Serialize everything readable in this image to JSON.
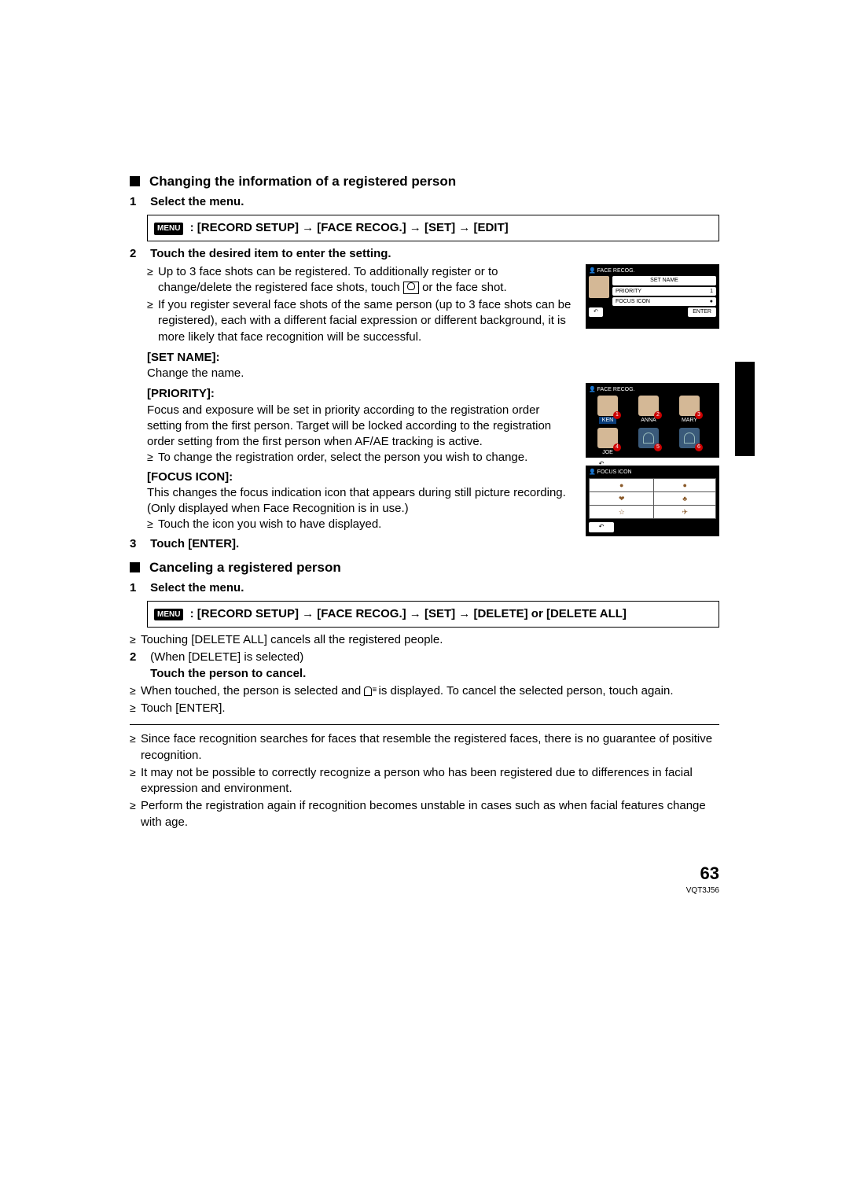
{
  "section1": {
    "title": "Changing the information of a registered person",
    "step1": {
      "num": "1",
      "title": "Select the menu."
    },
    "menu1": {
      "badge": "MENU",
      "path": ": [RECORD SETUP] → [FACE RECOG.] → [SET] → [EDIT]"
    },
    "step2": {
      "num": "2",
      "title": "Touch the desired item to enter the setting."
    },
    "bullets1": [
      "Up to 3 face shots can be registered. To additionally register or to change/delete the registered face shots, touch",
      "or the face shot.",
      "If you register several face shots of the same person (up to 3 face shots can be registered), each with a different facial expression or different background, it is more likely that face recognition will be successful."
    ],
    "setname": {
      "label": "[SET NAME]:",
      "text": "Change the name."
    },
    "priority": {
      "label": "[PRIORITY]:",
      "text": "Focus and exposure will be set in priority according to the registration order setting from the first person. Target will be locked according to the registration order setting from the first person when AF/AE tracking is active.",
      "bullet": "To change the registration order, select the person you wish to change."
    },
    "focusicon": {
      "label": "[FOCUS ICON]:",
      "text": "This changes the focus indication icon that appears during still picture recording. (Only displayed when Face Recognition is in use.)",
      "bullet": "Touch the icon you wish to have displayed."
    },
    "step3": {
      "num": "3",
      "title": "Touch [ENTER]."
    }
  },
  "section2": {
    "title": "Canceling a registered person",
    "step1": {
      "num": "1",
      "title": "Select the menu."
    },
    "menu2": {
      "badge": "MENU",
      "path": ": [RECORD SETUP] → [FACE RECOG.] → [SET] → [DELETE] or [DELETE ALL]"
    },
    "bullet1": "Touching [DELETE ALL] cancels all the registered people.",
    "step2": {
      "num": "2",
      "text": "(When [DELETE] is selected)",
      "title": "Touch the person to cancel."
    },
    "bullets2a": "When touched, the person is selected and",
    "bullets2b": "is displayed. To cancel the selected person, touch again.",
    "bullet3": "Touch [ENTER].",
    "notes": [
      "Since face recognition searches for faces that resemble the registered faces, there is no guarantee of positive recognition.",
      "It may not be possible to correctly recognize a person who has been registered due to differences in facial expression and environment.",
      "Perform the registration again if recognition becomes unstable in cases such as when facial features change with age."
    ]
  },
  "screens": {
    "s1": {
      "header": "FACE RECOG.",
      "btn_setname": "SET NAME",
      "btn_priority_l": "PRIORITY",
      "btn_priority_r": "1",
      "btn_focus_l": "FOCUS ICON",
      "btn_focus_r": "●",
      "back": "↶",
      "enter": "ENTER"
    },
    "s2": {
      "header": "FACE RECOG.",
      "people": [
        {
          "name": "KEN",
          "num": "1",
          "hl": true
        },
        {
          "name": "ANNA",
          "num": "2",
          "hl": false
        },
        {
          "name": "MARY",
          "num": "3",
          "hl": false
        },
        {
          "name": "JOE",
          "num": "4",
          "hl": false
        },
        {
          "name": "",
          "num": "5",
          "hl": false,
          "empty": true
        },
        {
          "name": "",
          "num": "6",
          "hl": false,
          "empty": true
        }
      ],
      "back": "↶"
    },
    "s3": {
      "header": "FOCUS ICON",
      "cells": [
        "●",
        "●",
        "❤",
        "♣",
        "☆",
        "✈"
      ],
      "back": "↶"
    }
  },
  "footer": {
    "page": "63",
    "code": "VQT3J56"
  }
}
